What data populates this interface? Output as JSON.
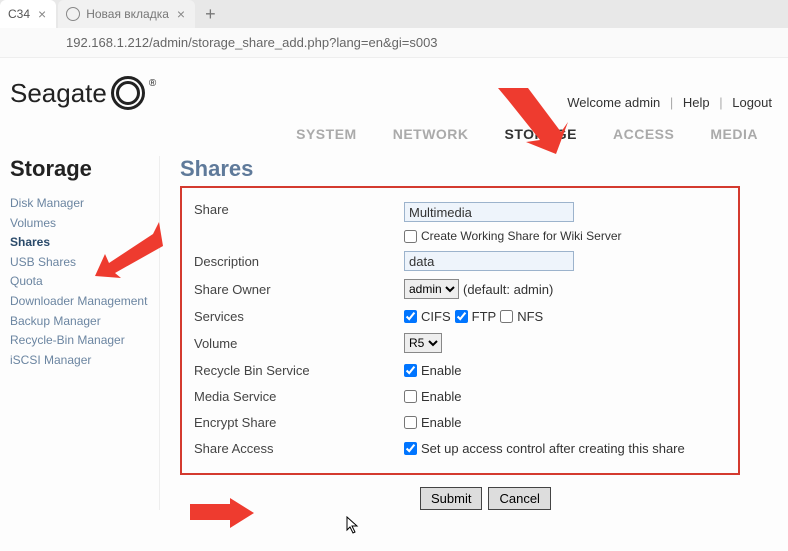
{
  "browser": {
    "tabs": [
      {
        "title": "C34"
      },
      {
        "title": "Новая вкладка"
      }
    ],
    "url": "192.168.1.212/admin/storage_share_add.php?lang=en&gi=s003"
  },
  "brand": {
    "name": "Seagate"
  },
  "userlinks": {
    "welcome": "Welcome admin",
    "help": "Help",
    "logout": "Logout"
  },
  "topnav": [
    {
      "label": "SYSTEM",
      "active": false
    },
    {
      "label": "NETWORK",
      "active": false
    },
    {
      "label": "STORAGE",
      "active": true
    },
    {
      "label": "ACCESS",
      "active": false
    },
    {
      "label": "MEDIA",
      "active": false
    }
  ],
  "sidebar": {
    "title": "Storage",
    "items": [
      {
        "label": "Disk Manager"
      },
      {
        "label": "Volumes"
      },
      {
        "label": "Shares"
      },
      {
        "label": "USB Shares"
      },
      {
        "label": "Quota"
      },
      {
        "label": "Downloader Management"
      },
      {
        "label": "Backup Manager"
      },
      {
        "label": "Recycle-Bin Manager"
      },
      {
        "label": "iSCSI Manager"
      }
    ],
    "active_index": 2
  },
  "page": {
    "title": "Shares",
    "form": {
      "share_label": "Share",
      "share_value": "Multimedia",
      "wiki_checkbox_label": "Create Working Share for Wiki Server",
      "desc_label": "Description",
      "desc_value": "data",
      "owner_label": "Share Owner",
      "owner_value": "admin",
      "owner_default_text": "(default: admin)",
      "services_label": "Services",
      "service_cifs": "CIFS",
      "service_ftp": "FTP",
      "service_nfs": "NFS",
      "volume_label": "Volume",
      "volume_value": "R5",
      "recyclebin_label": "Recycle Bin Service",
      "media_label": "Media Service",
      "encrypt_label": "Encrypt Share",
      "access_label": "Share Access",
      "enable_text": "Enable",
      "access_text": "Set up access control after creating this share",
      "submit": "Submit",
      "cancel": "Cancel"
    }
  }
}
